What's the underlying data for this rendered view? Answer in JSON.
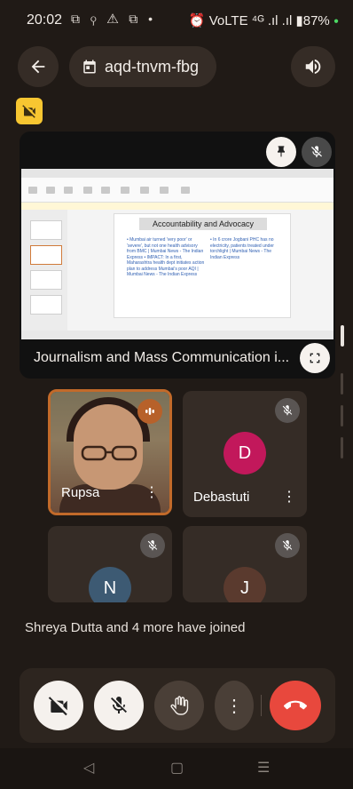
{
  "status": {
    "time": "20:02",
    "left_icons": "⧉ ⚲ ⚠ ⧉ •",
    "right": "⏰ VoLTE ⁴ᴳ .ıl .ıl ▮87%",
    "battery": "87%"
  },
  "header": {
    "meeting_code": "aqd-tnvm-fbg"
  },
  "presentation": {
    "label": "Journalism and Mass Communication i...",
    "slide_title": "Accountability and Advocacy",
    "bullets_left": "• Mumbai air turned 'very poor' or 'severe', but not one health advisory from BMC | Mumbai News - The Indian Express\n• IMPACT: In a first, Maharashtra health dept initiates action plan to address Mumbai's poor AQI | Mumbai News - The Indian Express",
    "bullets_right": "• In 6 crore Jogbani PHC has no electricity, patients treated under torchlight | Mumbai News - The Indian Express"
  },
  "participants": [
    {
      "name": "Rupsa",
      "initial": "",
      "speaking": true,
      "avatar_color": ""
    },
    {
      "name": "Debastuti",
      "initial": "D",
      "speaking": false,
      "avatar_color": "#c2185b"
    },
    {
      "name": "",
      "initial": "N",
      "speaking": false,
      "avatar_color": "#3d5a73"
    },
    {
      "name": "",
      "initial": "J",
      "speaking": false,
      "avatar_color": "#5a3a2e"
    }
  ],
  "notification": "Shreya Dutta and 4 more have joined",
  "controls": {
    "more_label": "⋮"
  },
  "nav": {
    "back": "◁",
    "home": "▢",
    "recents": "☰"
  },
  "colors": {
    "background": "#201a16",
    "accent": "#c26a2a",
    "end_call": "#e8483d",
    "badge": "#f7c631"
  }
}
